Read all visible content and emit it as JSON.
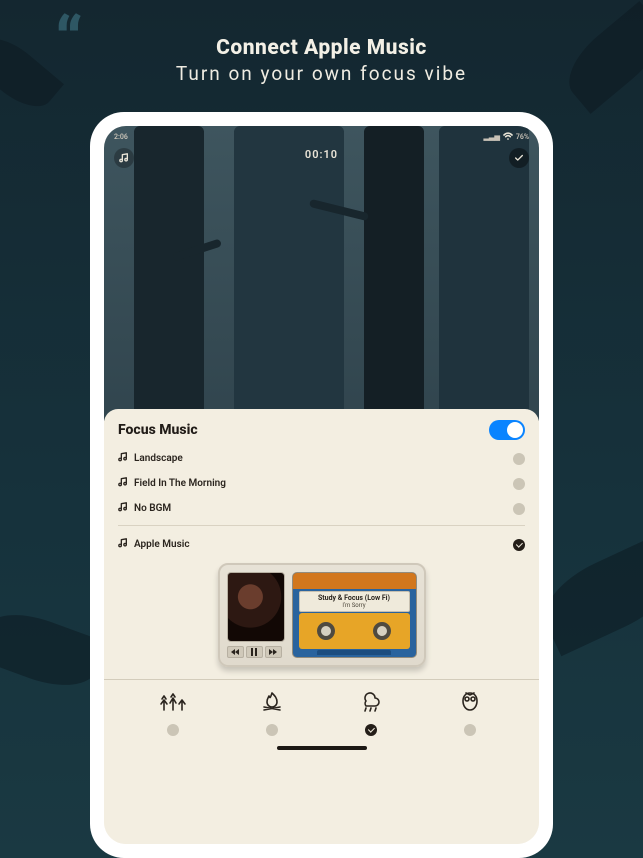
{
  "promo": {
    "title": "Connect Apple Music",
    "subtitle": "Turn on your own focus vibe"
  },
  "status": {
    "time": "2:06",
    "signal": "▂▃▅",
    "wifi": "wifi",
    "battery": "76%"
  },
  "forest": {
    "timer": "00:10"
  },
  "sheet": {
    "title": "Focus Music",
    "toggle_on": true,
    "tracks": [
      {
        "label": "Landscape",
        "selected": false
      },
      {
        "label": "Field In The Morning",
        "selected": false
      },
      {
        "label": "No BGM",
        "selected": false
      },
      {
        "label": "Apple Music",
        "selected": true
      }
    ]
  },
  "player": {
    "title": "Study & Focus (Low Fi)",
    "subtitle": "I'm Sorry",
    "controls": [
      "prev",
      "pause",
      "next"
    ]
  },
  "ambience": {
    "tabs": [
      {
        "name": "forest-icon",
        "selected": false
      },
      {
        "name": "fire-icon",
        "selected": false
      },
      {
        "name": "rain-icon",
        "selected": true
      },
      {
        "name": "owl-icon",
        "selected": false
      }
    ]
  }
}
